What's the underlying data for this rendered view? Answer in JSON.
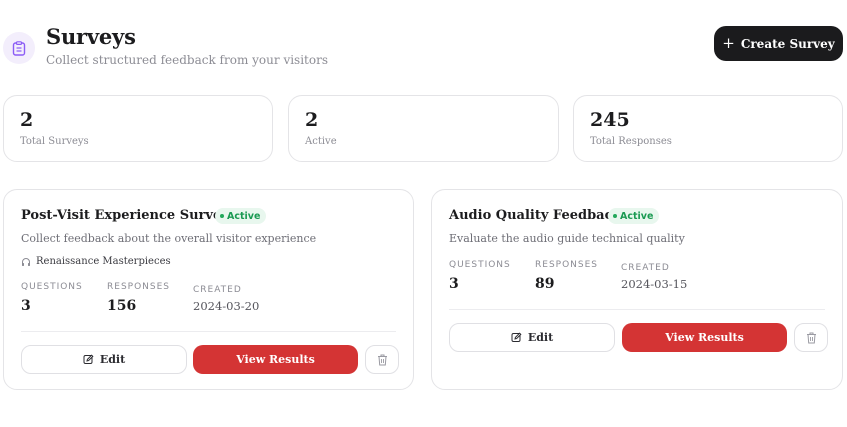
{
  "header": {
    "title": "Surveys",
    "subtitle": "Collect structured feedback from your visitors",
    "icon": "clipboard-icon",
    "accent_color": "#8b5cf6"
  },
  "create_button": {
    "label": "Create Survey",
    "icon": "plus-icon"
  },
  "stats": [
    {
      "value": "2",
      "label": "Total Surveys"
    },
    {
      "value": "2",
      "label": "Active"
    },
    {
      "value": "245",
      "label": "Total Responses"
    }
  ],
  "surveys": [
    {
      "title": "Post-Visit Experience Survey",
      "status": "Active",
      "description": "Collect feedback about the overall visitor experience",
      "exhibit": "Renaissance Masterpieces",
      "questions_label": "QUESTIONS",
      "questions": "3",
      "responses_label": "RESPONSES",
      "responses": "156",
      "created_label": "CREATED",
      "created": "2024-03-20",
      "edit_label": "Edit",
      "results_label": "View Results"
    },
    {
      "title": "Audio Quality Feedback",
      "status": "Active",
      "description": "Evaluate the audio guide technical quality",
      "questions_label": "QUESTIONS",
      "questions": "3",
      "responses_label": "RESPONSES",
      "responses": "89",
      "created_label": "CREATED",
      "created": "2024-03-15",
      "edit_label": "Edit",
      "results_label": "View Results"
    }
  ],
  "colors": {
    "primary_button": "#1b1b1d",
    "results_button": "#d43434",
    "active_badge_bg": "#e8f7ee",
    "active_badge_text": "#1a9a52"
  }
}
